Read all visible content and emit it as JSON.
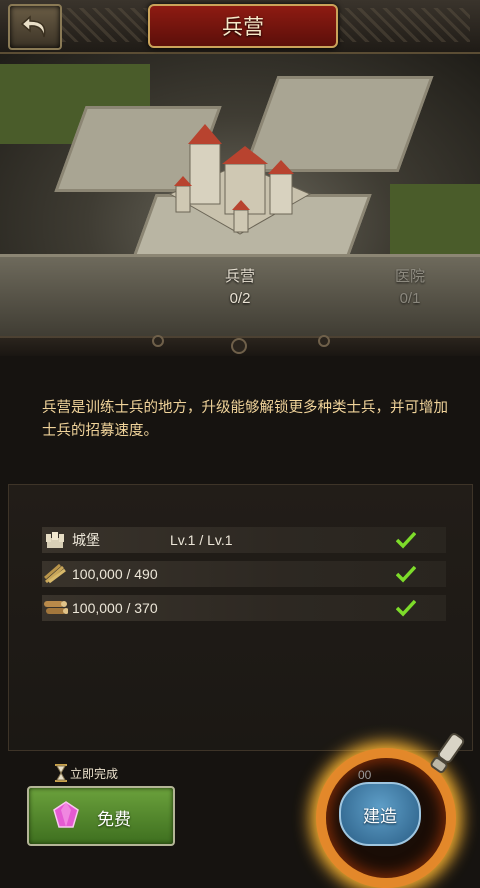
{
  "header": {
    "title": "兵营",
    "back_icon": "back-arrow-icon"
  },
  "scene": {
    "barracks": {
      "name": "兵营",
      "count": "0/2"
    },
    "hospital": {
      "name": "医院",
      "count": "0/1"
    }
  },
  "description": "兵营是训练士兵的地方，升级能够解锁更多种类士兵，并可增加士兵的招募速度。",
  "requirements": [
    {
      "icon": "castle-icon",
      "name": "城堡",
      "value": "Lv.1 / Lv.1",
      "met": true
    },
    {
      "icon": "wheat-icon",
      "name": "",
      "value": "100,000 / 490",
      "met": true
    },
    {
      "icon": "wood-logs-icon",
      "name": "",
      "value": "100,000 / 370",
      "met": true
    }
  ],
  "actions": {
    "instant_label": "立即完成",
    "free_label": "免费",
    "build_label": "建造",
    "timer_text": "00"
  },
  "colors": {
    "title_red": "#8e1b12",
    "desc_text": "#f0d39a",
    "check_green": "#7ddc2a",
    "free_green": "#6ba13c",
    "build_blue": "#2a5e86"
  }
}
